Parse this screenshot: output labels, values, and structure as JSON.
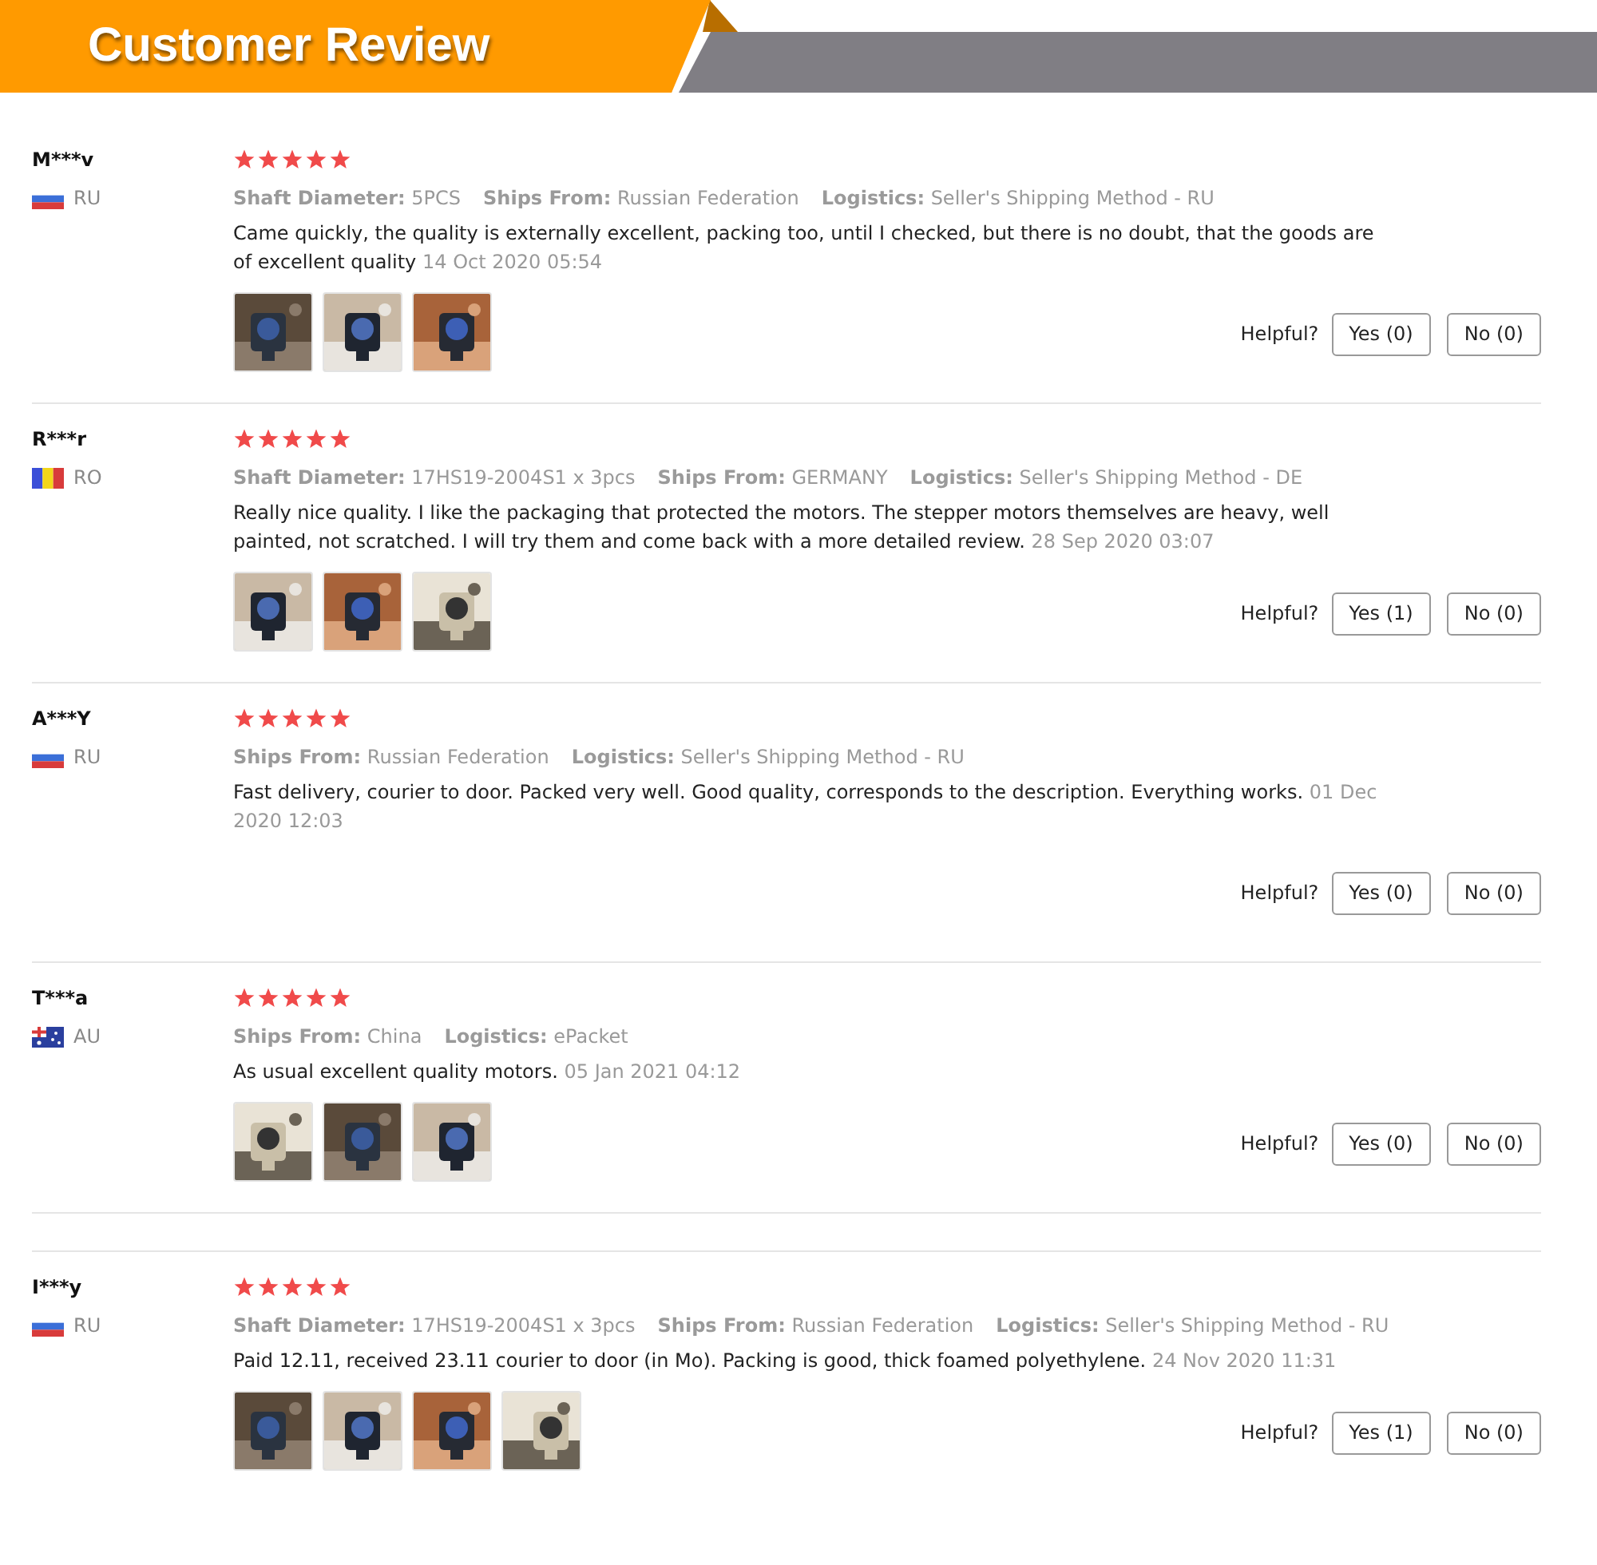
{
  "header": {
    "title": "Customer Review"
  },
  "reviews": [
    {
      "name": "M***v",
      "country": "RU",
      "flag": {
        "kind": "horizontal"
      },
      "stars": 5,
      "details": [
        {
          "label": "Shaft Diameter:",
          "value": "5PCS"
        },
        {
          "label": "Ships From:",
          "value": "Russian Federation"
        },
        {
          "label": "Logistics:",
          "value": "Seller's Shipping Method - RU"
        }
      ],
      "text": "Came quickly, the quality is externally excellent, packing too, until I checked, but there is no doubt, that the goods are of excellent quality",
      "date": "14 Oct 2020 05:54",
      "photos": [
        {
          "kind": "picture"
        },
        {
          "kind": "picture"
        },
        {
          "kind": "picture"
        }
      ],
      "helpful_label": "Helpful?",
      "yes": "Yes (0)",
      "no": "No (0)",
      "divider_before": false
    },
    {
      "name": "R***r",
      "country": "RO",
      "flag": {
        "kind": "vertical"
      },
      "stars": 5,
      "details": [
        {
          "label": "Shaft Diameter:",
          "value": "17HS19-2004S1 x 3pcs"
        },
        {
          "label": "Ships From:",
          "value": "GERMANY"
        },
        {
          "label": "Logistics:",
          "value": "Seller's Shipping Method - DE"
        }
      ],
      "text": "Really nice quality. I like the packaging that protected the motors. The stepper motors themselves are heavy, well painted, not scratched. I will try them and come back with a more detailed review.",
      "date": "28 Sep 2020 03:07",
      "photos": [
        {
          "kind": "picture"
        },
        {
          "kind": "picture"
        },
        {
          "kind": "picture"
        }
      ],
      "helpful_label": "Helpful?",
      "yes": "Yes (1)",
      "no": "No (0)",
      "divider_before": false
    },
    {
      "name": "A***Y",
      "country": "RU",
      "flag": {
        "kind": "horizontal"
      },
      "stars": 5,
      "details": [
        {
          "label": "Ships From:",
          "value": "Russian Federation"
        },
        {
          "label": "Logistics:",
          "value": "Seller's Shipping Method - RU"
        }
      ],
      "text": "Fast delivery, courier to door. Packed very well. Good quality, corresponds to the description. Everything works.",
      "date": "01 Dec 2020 12:03",
      "helpful_label": "Helpful?",
      "yes": "Yes (0)",
      "no": "No (0)",
      "divider_before": false
    },
    {
      "name": "T***a",
      "country": "AU",
      "flag": {
        "kind": "union"
      },
      "stars": 5,
      "details": [
        {
          "label": "Ships From:",
          "value": "China"
        },
        {
          "label": "Logistics:",
          "value": "ePacket"
        }
      ],
      "text": "As usual excellent quality motors.",
      "date": "05 Jan 2021 04:12",
      "photos": [
        {
          "kind": "picture"
        },
        {
          "kind": "picture"
        },
        {
          "kind": "picture"
        }
      ],
      "helpful_label": "Helpful?",
      "yes": "Yes (0)",
      "no": "No (0)",
      "divider_before": false
    },
    {
      "name": "I***y",
      "country": "RU",
      "flag": {
        "kind": "horizontal"
      },
      "stars": 5,
      "details": [
        {
          "label": "Shaft Diameter:",
          "value": "17HS19-2004S1 x 3pcs"
        },
        {
          "label": "Ships From:",
          "value": "Russian Federation"
        },
        {
          "label": "Logistics:",
          "value": "Seller's Shipping Method - RU"
        }
      ],
      "text": "Paid 12.11, received 23.11 courier to door (in Mo). Packing is good, thick foamed polyethylene.",
      "date": "24 Nov 2020 11:31",
      "photos": [
        {
          "kind": "picture"
        },
        {
          "kind": "picture"
        },
        {
          "kind": "picture"
        },
        {
          "kind": "picture"
        }
      ],
      "helpful_label": "Helpful?",
      "yes": "Yes (1)",
      "no": "No (0)",
      "divider_before": true
    }
  ]
}
